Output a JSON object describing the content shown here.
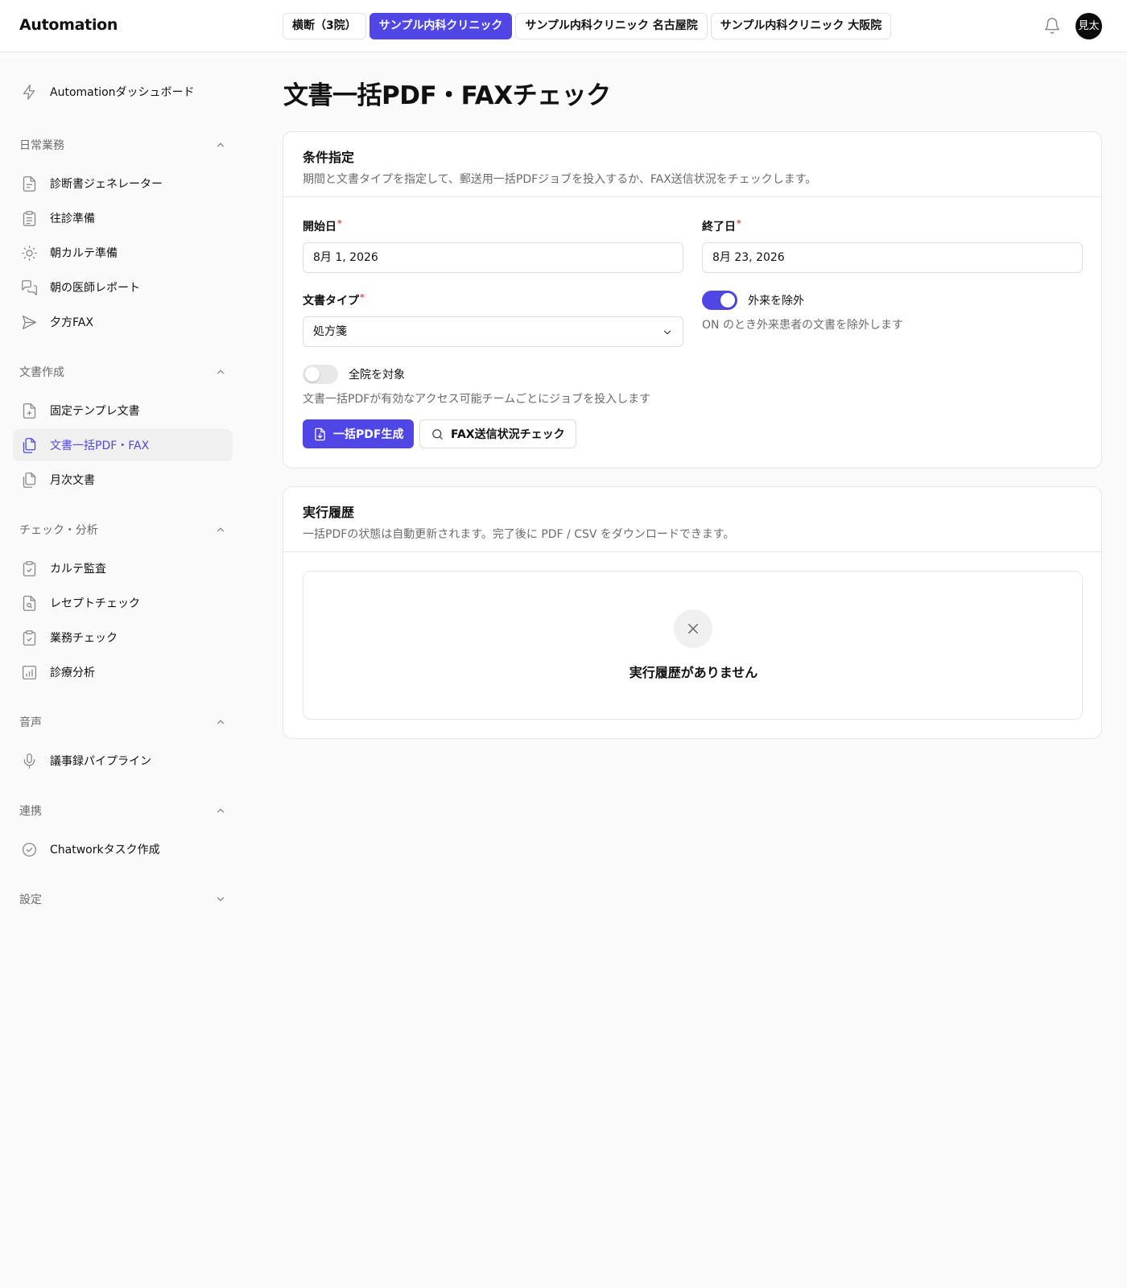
{
  "app": {
    "logo": "Automation"
  },
  "header": {
    "tabs": [
      {
        "label": "横断（3院）",
        "active": false
      },
      {
        "label": "サンプル内科クリニック",
        "active": true
      },
      {
        "label": "サンプル内科クリニック 名古屋院",
        "active": false
      },
      {
        "label": "サンプル内科クリニック 大阪院",
        "active": false
      }
    ],
    "avatar": "見太"
  },
  "sidebar": {
    "dashboard": {
      "label": "Automationダッシュボード",
      "icon": "lightning-icon"
    },
    "groups": [
      {
        "title": "日常業務",
        "expanded": true,
        "items": [
          {
            "label": "診断書ジェネレーター",
            "icon": "document-icon"
          },
          {
            "label": "往診準備",
            "icon": "clipboard-icon"
          },
          {
            "label": "朝カルテ準備",
            "icon": "sun-icon"
          },
          {
            "label": "朝の医師レポート",
            "icon": "chat-icon"
          },
          {
            "label": "夕方FAX",
            "icon": "send-icon"
          }
        ]
      },
      {
        "title": "文書作成",
        "expanded": true,
        "items": [
          {
            "label": "固定テンプレ文書",
            "icon": "file-plus-icon"
          },
          {
            "label": "文書一括PDF・FAX",
            "icon": "files-icon",
            "active": true
          },
          {
            "label": "月次文書",
            "icon": "files-icon"
          }
        ]
      },
      {
        "title": "チェック・分析",
        "expanded": true,
        "items": [
          {
            "label": "カルテ監査",
            "icon": "clipboard-check-icon"
          },
          {
            "label": "レセプトチェック",
            "icon": "file-search-icon"
          },
          {
            "label": "業務チェック",
            "icon": "clipboard-check-icon"
          },
          {
            "label": "診療分析",
            "icon": "bar-chart-icon"
          }
        ]
      },
      {
        "title": "音声",
        "expanded": true,
        "items": [
          {
            "label": "議事録パイプライン",
            "icon": "mic-icon"
          }
        ]
      },
      {
        "title": "連携",
        "expanded": true,
        "items": [
          {
            "label": "Chatworkタスク作成",
            "icon": "check-circle-icon"
          }
        ]
      },
      {
        "title": "設定",
        "expanded": false,
        "items": []
      }
    ]
  },
  "main": {
    "title": "文書一括PDF・FAXチェック",
    "conditions": {
      "title": "条件指定",
      "description": "期間と文書タイプを指定して、郵送用一括PDFジョブを投入するか、FAX送信状況をチェックします。",
      "start_date": {
        "label": "開始日",
        "required_mark": "*",
        "value": "8月 1, 2026"
      },
      "end_date": {
        "label": "終了日",
        "required_mark": "*",
        "value": "8月 23, 2026"
      },
      "doc_type": {
        "label": "文書タイプ",
        "required_mark": "*",
        "value": "処方箋"
      },
      "exclude_outpatient": {
        "label": "外来を除外",
        "on": true,
        "hint": "ON のとき外来患者の文書を除外します"
      },
      "all_clinics": {
        "label": "全院を対象",
        "on": false,
        "hint": "文書一括PDFが有効なアクセス可能チームごとにジョブを投入します"
      },
      "generate_button": "一括PDF生成",
      "fax_check_button": "FAX送信状況チェック"
    },
    "history": {
      "title": "実行履歴",
      "description": "一括PDFの状態は自動更新されます。完了後に PDF / CSV をダウンロードできます。",
      "empty_message": "実行履歴がありません"
    }
  },
  "colors": {
    "accent": "#4f46e5",
    "required": "#e5484d"
  }
}
